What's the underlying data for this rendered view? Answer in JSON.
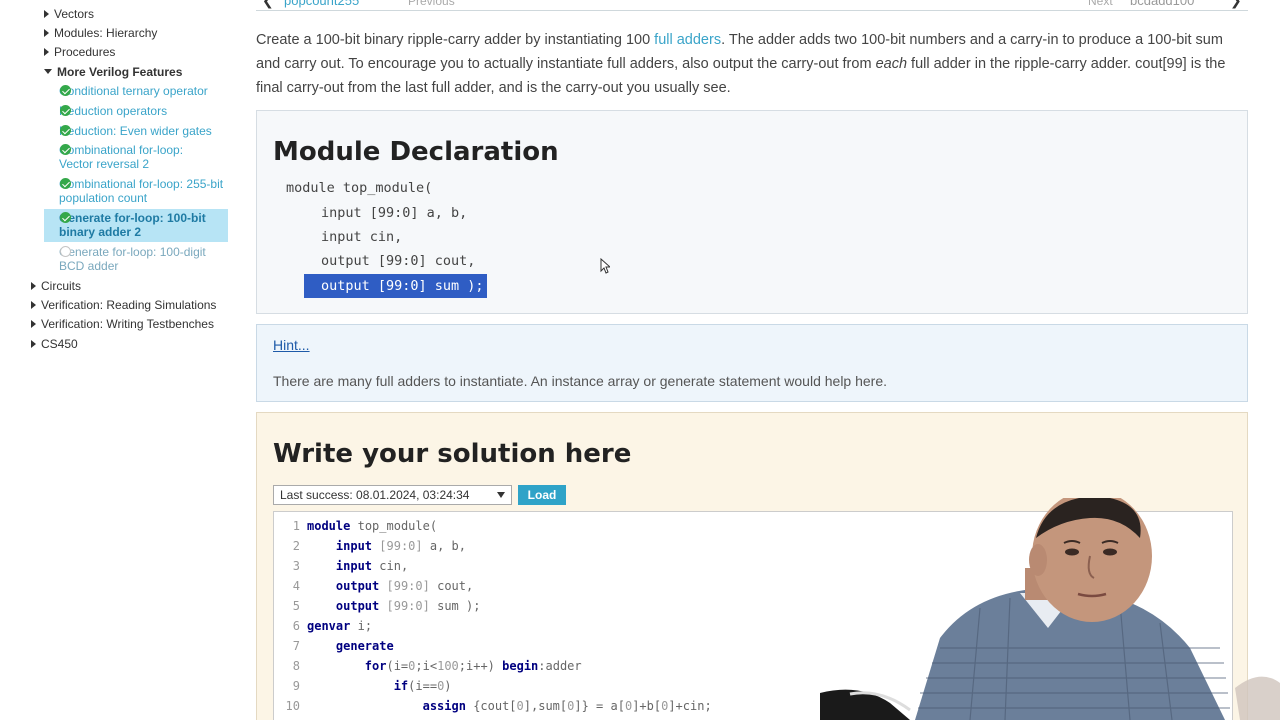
{
  "sidebar": {
    "top_items": [
      {
        "label": "Vectors"
      },
      {
        "label": "Modules: Hierarchy"
      },
      {
        "label": "Procedures"
      },
      {
        "label": "More Verilog Features"
      }
    ],
    "sub_items": [
      {
        "label": "Conditional ternary operator",
        "status": "done"
      },
      {
        "label": "Reduction operators",
        "status": "done"
      },
      {
        "label": "Reduction: Even wider gates",
        "status": "done"
      },
      {
        "label": "Combinational for-loop: Vector reversal 2",
        "status": "done"
      },
      {
        "label": "Combinational for-loop: 255-bit population count",
        "status": "done"
      },
      {
        "label": "Generate for-loop: 100-bit binary adder 2",
        "status": "done",
        "active": true
      },
      {
        "label": "Generate for-loop: 100-digit BCD adder",
        "status": "todo"
      }
    ],
    "bottom_items": [
      {
        "label": "Circuits"
      },
      {
        "label": "Verification: Reading Simulations"
      },
      {
        "label": "Verification: Writing Testbenches"
      },
      {
        "label": "CS450"
      }
    ]
  },
  "topnav": {
    "prev_arrow": "❮",
    "prev_link": "popcount255",
    "prev_label": "Previous",
    "next_label": "Next",
    "next_link": "bcdadd100",
    "next_arrow": "❯"
  },
  "description": {
    "part1": "Create a 100-bit binary ripple-carry adder by instantiating 100 ",
    "link": "full adders",
    "part2": ". The adder adds two 100-bit numbers and a carry-in to produce a 100-bit sum and carry out. To encourage you to actually instantiate full adders, also output the carry-out from ",
    "emph": "each",
    "part3": " full adder in the ripple-carry adder. cout[99] is the final carry-out from the last full adder, and is the carry-out you usually see."
  },
  "module_declaration": {
    "title": "Module Declaration",
    "lines": [
      "module top_module(",
      "input [99:0] a, b,",
      "input cin,",
      "output [99:0] cout,",
      "output [99:0] sum );"
    ]
  },
  "hint": {
    "link": "Hint...",
    "text": "There are many full adders to instantiate. An instance array or generate statement would help here."
  },
  "solution": {
    "title": "Write your solution here",
    "history_selected": "Last success: 08.01.2024, 03:24:34",
    "load_label": "Load",
    "line_numbers": [
      "1",
      "2",
      "3",
      "4",
      "5",
      "6",
      "7",
      "8",
      "9",
      "10"
    ]
  },
  "colors": {
    "link": "#3aa4c9",
    "done_check": "#34a84a",
    "active_bg": "#b7e4f5",
    "selection": "#2f5dc4",
    "load_button": "#2fa3c8"
  }
}
